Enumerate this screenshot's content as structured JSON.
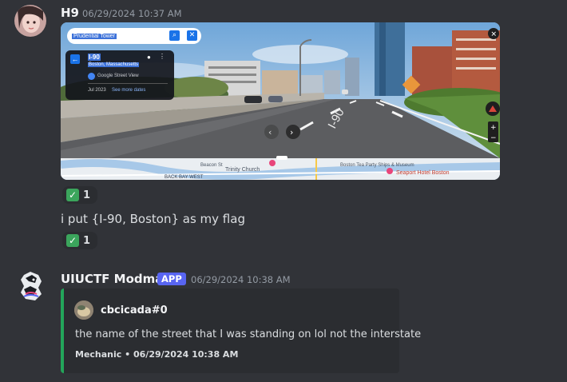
{
  "messages": [
    {
      "username": "H9",
      "timestamp": "06/29/2024 10:37 AM",
      "attachment": {
        "search_text": "Prudential Tower",
        "road_label": "I-90",
        "panel": {
          "title": "I-90",
          "subtitle": "Boston, Massachusetts",
          "source": "Google Street View",
          "date": "Jul 2023",
          "more_dates": "See more dates"
        },
        "map_labels": [
          "Trinity Church",
          "BACK BAY WEST",
          "Beacon St",
          "Boston Tea Party Ships & Museum",
          "Seaport Hotel Boston"
        ]
      },
      "reaction_1": {
        "emoji": "✓",
        "count": "1"
      },
      "text": "i put {I-90, Boston} as my flag",
      "reaction_2": {
        "emoji": "✓",
        "count": "1"
      }
    },
    {
      "username": "UIUCTF Modmail",
      "badge": "APP",
      "timestamp": "06/29/2024 10:38 AM",
      "embed": {
        "author": "cbcicada#0",
        "description": "the name of the street that I was standing on lol not the interstate",
        "footer": "Mechanic • 06/29/2024 10:38 AM",
        "accent": "#23a55a"
      }
    }
  ],
  "colors": {
    "background": "#313338",
    "brand": "#5865f2",
    "reaction_bg": "#2b2d31"
  }
}
